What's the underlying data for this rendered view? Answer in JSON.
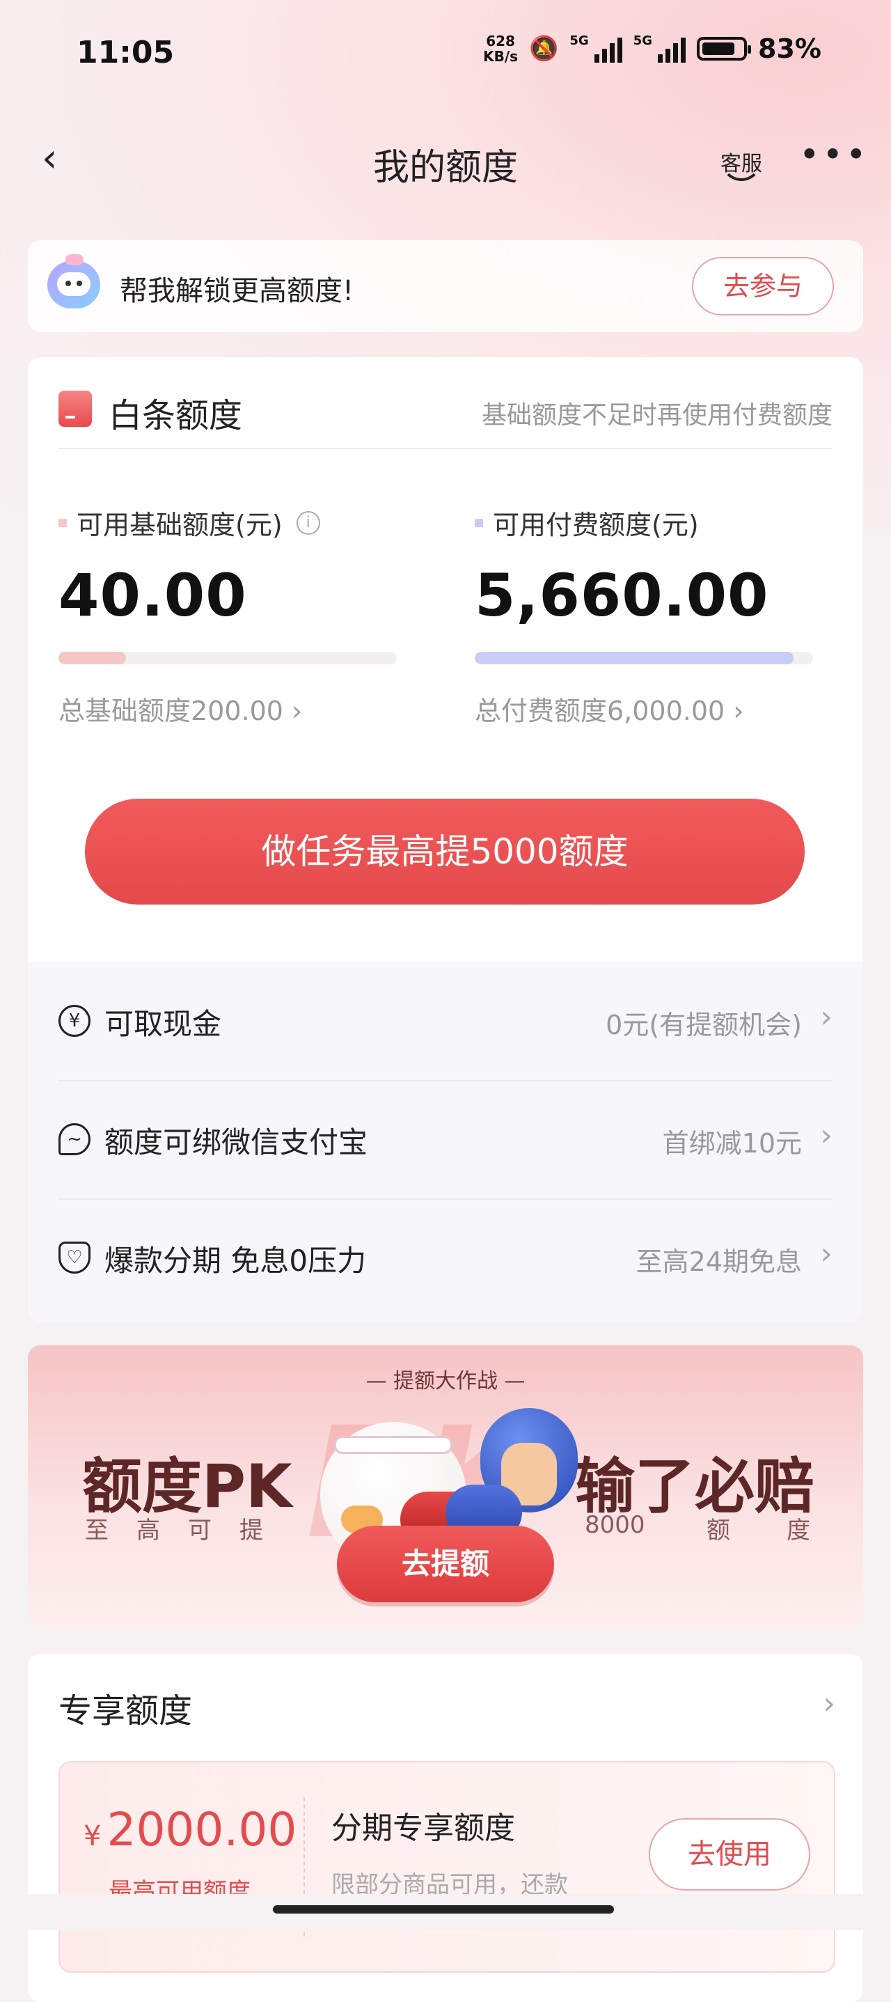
{
  "status": {
    "time": "11:05",
    "net_speed": "628",
    "net_unit": "KB/s",
    "net1": "5G",
    "net2": "5G",
    "battery": "83%"
  },
  "nav": {
    "title": "我的额度",
    "service": "客服"
  },
  "invite": {
    "text": "帮我解锁更高额度!",
    "button": "去参与"
  },
  "card": {
    "title": "白条额度",
    "hint": "基础额度不足时再使用付费额度",
    "basic": {
      "label": "可用基础额度(元)",
      "amount": "40.00",
      "total": "总基础额度200.00",
      "progress": 0.2,
      "color": "#f5c6c6"
    },
    "paid": {
      "label": "可用付费额度(元)",
      "amount": "5,660.00",
      "total": "总付费额度6,000.00",
      "progress": 0.943,
      "color": "#c9cdf5"
    },
    "cta": "做任务最高提5000额度"
  },
  "rows": [
    {
      "label": "可取现金",
      "value": "0元(有提额机会)",
      "icon": "yuan-icon"
    },
    {
      "label": "额度可绑微信支付宝",
      "value": "首绑减10元",
      "icon": "chat-icon"
    },
    {
      "label": "爆款分期 免息0压力",
      "value": "至高24期免息",
      "icon": "heart-shield-icon"
    }
  ],
  "promo": {
    "tag": "— 提额大作战 —",
    "left_big": "额度PK",
    "left_small": "至高可提",
    "right_big": "输了必赔",
    "right_small_1": "8000",
    "right_small_2": "额",
    "right_small_3": "度",
    "button": "去提额"
  },
  "exclusive": {
    "title": "专享额度",
    "currency": "¥",
    "amount": "2000.00",
    "caption": "最高可用额度",
    "name": "分期专享额度",
    "desc": "限部分商品可用，还款",
    "button": "去使用"
  }
}
